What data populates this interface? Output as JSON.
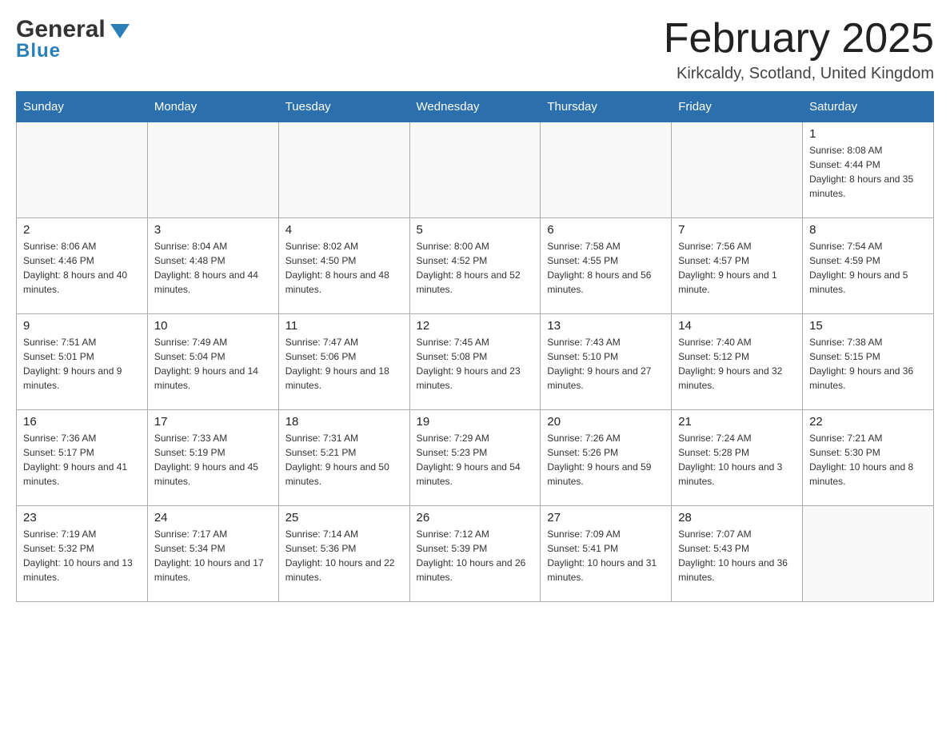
{
  "header": {
    "logo_name": "General",
    "logo_sub": "Blue",
    "month_title": "February 2025",
    "location": "Kirkcaldy, Scotland, United Kingdom"
  },
  "weekdays": [
    "Sunday",
    "Monday",
    "Tuesday",
    "Wednesday",
    "Thursday",
    "Friday",
    "Saturday"
  ],
  "weeks": [
    [
      {
        "day": "",
        "info": ""
      },
      {
        "day": "",
        "info": ""
      },
      {
        "day": "",
        "info": ""
      },
      {
        "day": "",
        "info": ""
      },
      {
        "day": "",
        "info": ""
      },
      {
        "day": "",
        "info": ""
      },
      {
        "day": "1",
        "info": "Sunrise: 8:08 AM\nSunset: 4:44 PM\nDaylight: 8 hours and 35 minutes."
      }
    ],
    [
      {
        "day": "2",
        "info": "Sunrise: 8:06 AM\nSunset: 4:46 PM\nDaylight: 8 hours and 40 minutes."
      },
      {
        "day": "3",
        "info": "Sunrise: 8:04 AM\nSunset: 4:48 PM\nDaylight: 8 hours and 44 minutes."
      },
      {
        "day": "4",
        "info": "Sunrise: 8:02 AM\nSunset: 4:50 PM\nDaylight: 8 hours and 48 minutes."
      },
      {
        "day": "5",
        "info": "Sunrise: 8:00 AM\nSunset: 4:52 PM\nDaylight: 8 hours and 52 minutes."
      },
      {
        "day": "6",
        "info": "Sunrise: 7:58 AM\nSunset: 4:55 PM\nDaylight: 8 hours and 56 minutes."
      },
      {
        "day": "7",
        "info": "Sunrise: 7:56 AM\nSunset: 4:57 PM\nDaylight: 9 hours and 1 minute."
      },
      {
        "day": "8",
        "info": "Sunrise: 7:54 AM\nSunset: 4:59 PM\nDaylight: 9 hours and 5 minutes."
      }
    ],
    [
      {
        "day": "9",
        "info": "Sunrise: 7:51 AM\nSunset: 5:01 PM\nDaylight: 9 hours and 9 minutes."
      },
      {
        "day": "10",
        "info": "Sunrise: 7:49 AM\nSunset: 5:04 PM\nDaylight: 9 hours and 14 minutes."
      },
      {
        "day": "11",
        "info": "Sunrise: 7:47 AM\nSunset: 5:06 PM\nDaylight: 9 hours and 18 minutes."
      },
      {
        "day": "12",
        "info": "Sunrise: 7:45 AM\nSunset: 5:08 PM\nDaylight: 9 hours and 23 minutes."
      },
      {
        "day": "13",
        "info": "Sunrise: 7:43 AM\nSunset: 5:10 PM\nDaylight: 9 hours and 27 minutes."
      },
      {
        "day": "14",
        "info": "Sunrise: 7:40 AM\nSunset: 5:12 PM\nDaylight: 9 hours and 32 minutes."
      },
      {
        "day": "15",
        "info": "Sunrise: 7:38 AM\nSunset: 5:15 PM\nDaylight: 9 hours and 36 minutes."
      }
    ],
    [
      {
        "day": "16",
        "info": "Sunrise: 7:36 AM\nSunset: 5:17 PM\nDaylight: 9 hours and 41 minutes."
      },
      {
        "day": "17",
        "info": "Sunrise: 7:33 AM\nSunset: 5:19 PM\nDaylight: 9 hours and 45 minutes."
      },
      {
        "day": "18",
        "info": "Sunrise: 7:31 AM\nSunset: 5:21 PM\nDaylight: 9 hours and 50 minutes."
      },
      {
        "day": "19",
        "info": "Sunrise: 7:29 AM\nSunset: 5:23 PM\nDaylight: 9 hours and 54 minutes."
      },
      {
        "day": "20",
        "info": "Sunrise: 7:26 AM\nSunset: 5:26 PM\nDaylight: 9 hours and 59 minutes."
      },
      {
        "day": "21",
        "info": "Sunrise: 7:24 AM\nSunset: 5:28 PM\nDaylight: 10 hours and 3 minutes."
      },
      {
        "day": "22",
        "info": "Sunrise: 7:21 AM\nSunset: 5:30 PM\nDaylight: 10 hours and 8 minutes."
      }
    ],
    [
      {
        "day": "23",
        "info": "Sunrise: 7:19 AM\nSunset: 5:32 PM\nDaylight: 10 hours and 13 minutes."
      },
      {
        "day": "24",
        "info": "Sunrise: 7:17 AM\nSunset: 5:34 PM\nDaylight: 10 hours and 17 minutes."
      },
      {
        "day": "25",
        "info": "Sunrise: 7:14 AM\nSunset: 5:36 PM\nDaylight: 10 hours and 22 minutes."
      },
      {
        "day": "26",
        "info": "Sunrise: 7:12 AM\nSunset: 5:39 PM\nDaylight: 10 hours and 26 minutes."
      },
      {
        "day": "27",
        "info": "Sunrise: 7:09 AM\nSunset: 5:41 PM\nDaylight: 10 hours and 31 minutes."
      },
      {
        "day": "28",
        "info": "Sunrise: 7:07 AM\nSunset: 5:43 PM\nDaylight: 10 hours and 36 minutes."
      },
      {
        "day": "",
        "info": ""
      }
    ]
  ]
}
